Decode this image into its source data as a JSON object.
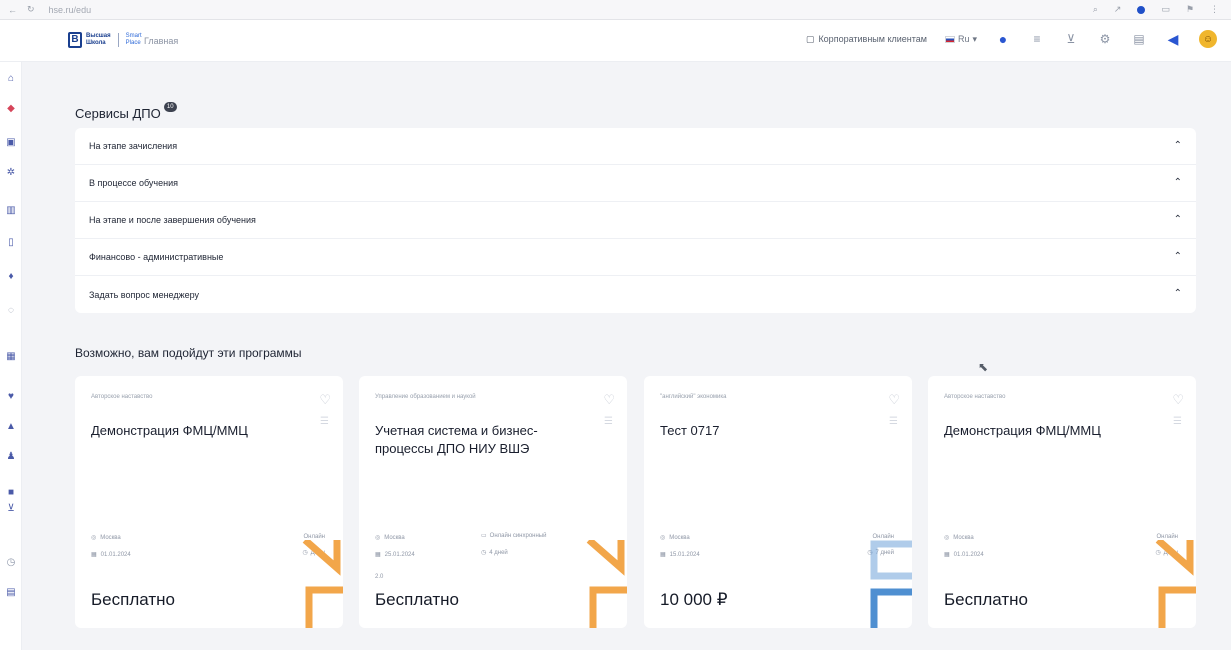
{
  "browser": {
    "url": "hse.ru/edu",
    "theme_dot": "#2050c8"
  },
  "header": {
    "logo_line1": "Высшая",
    "logo_line2": "Школа",
    "logo_line3": "Smart",
    "logo_line4": "Place",
    "home": "Главная",
    "support": "Корпоративным клиентам",
    "lang": "Ru"
  },
  "sidebar": {
    "icons": [
      "home-icon",
      "bookmark-icon",
      "bag-icon",
      "gear-icon",
      "chart-icon",
      "document-icon",
      "pin-icon",
      "chat-icon",
      "building-icon",
      "heart-icon",
      "like-icon",
      "people-icon",
      "briefcase-icon",
      "cart-icon",
      "clock-icon",
      "archive-icon"
    ]
  },
  "services": {
    "title": "Сервисы ДПО",
    "badge": "10",
    "items": [
      {
        "label": "На этапе зачисления"
      },
      {
        "label": "В процессе обучения"
      },
      {
        "label": "На этапе и после завершения обучения"
      },
      {
        "label": "Финансово - административные"
      },
      {
        "label": "Задать вопрос менеджеру"
      }
    ]
  },
  "recommendations": {
    "title": "Возможно, вам подойдут эти программы",
    "cards": [
      {
        "category": "Авторское наставство",
        "title": "Демонстрация ФМЦ/ММЦ",
        "city": "Москва",
        "format": "Онлайн",
        "date": "01.01.2024",
        "duration": "Даты",
        "level": "",
        "price": "Бесплатно",
        "accent": "#f2a64a"
      },
      {
        "category": "Управление образованием и наукой",
        "title": "Учетная система и бизнес-процессы ДПО НИУ ВШЭ",
        "city": "Москва",
        "format": "Онлайн синхронный",
        "date": "25.01.2024",
        "duration": "4 дней",
        "level": "2.0",
        "price": "Бесплатно",
        "accent": "#f2a64a"
      },
      {
        "category": "\"английский\" экономика",
        "title": "Тест 0717",
        "city": "Москва",
        "format": "Онлайн",
        "date": "15.01.2024",
        "duration": "7 дней",
        "level": "",
        "price": "10 000 ₽",
        "accent": "#4f8fd1"
      },
      {
        "category": "Авторское наставство",
        "title": "Демонстрация ФМЦ/ММЦ",
        "city": "Москва",
        "format": "Онлайн",
        "date": "01.01.2024",
        "duration": "Даты",
        "level": "",
        "price": "Бесплатно",
        "accent": "#f2a64a"
      }
    ]
  }
}
